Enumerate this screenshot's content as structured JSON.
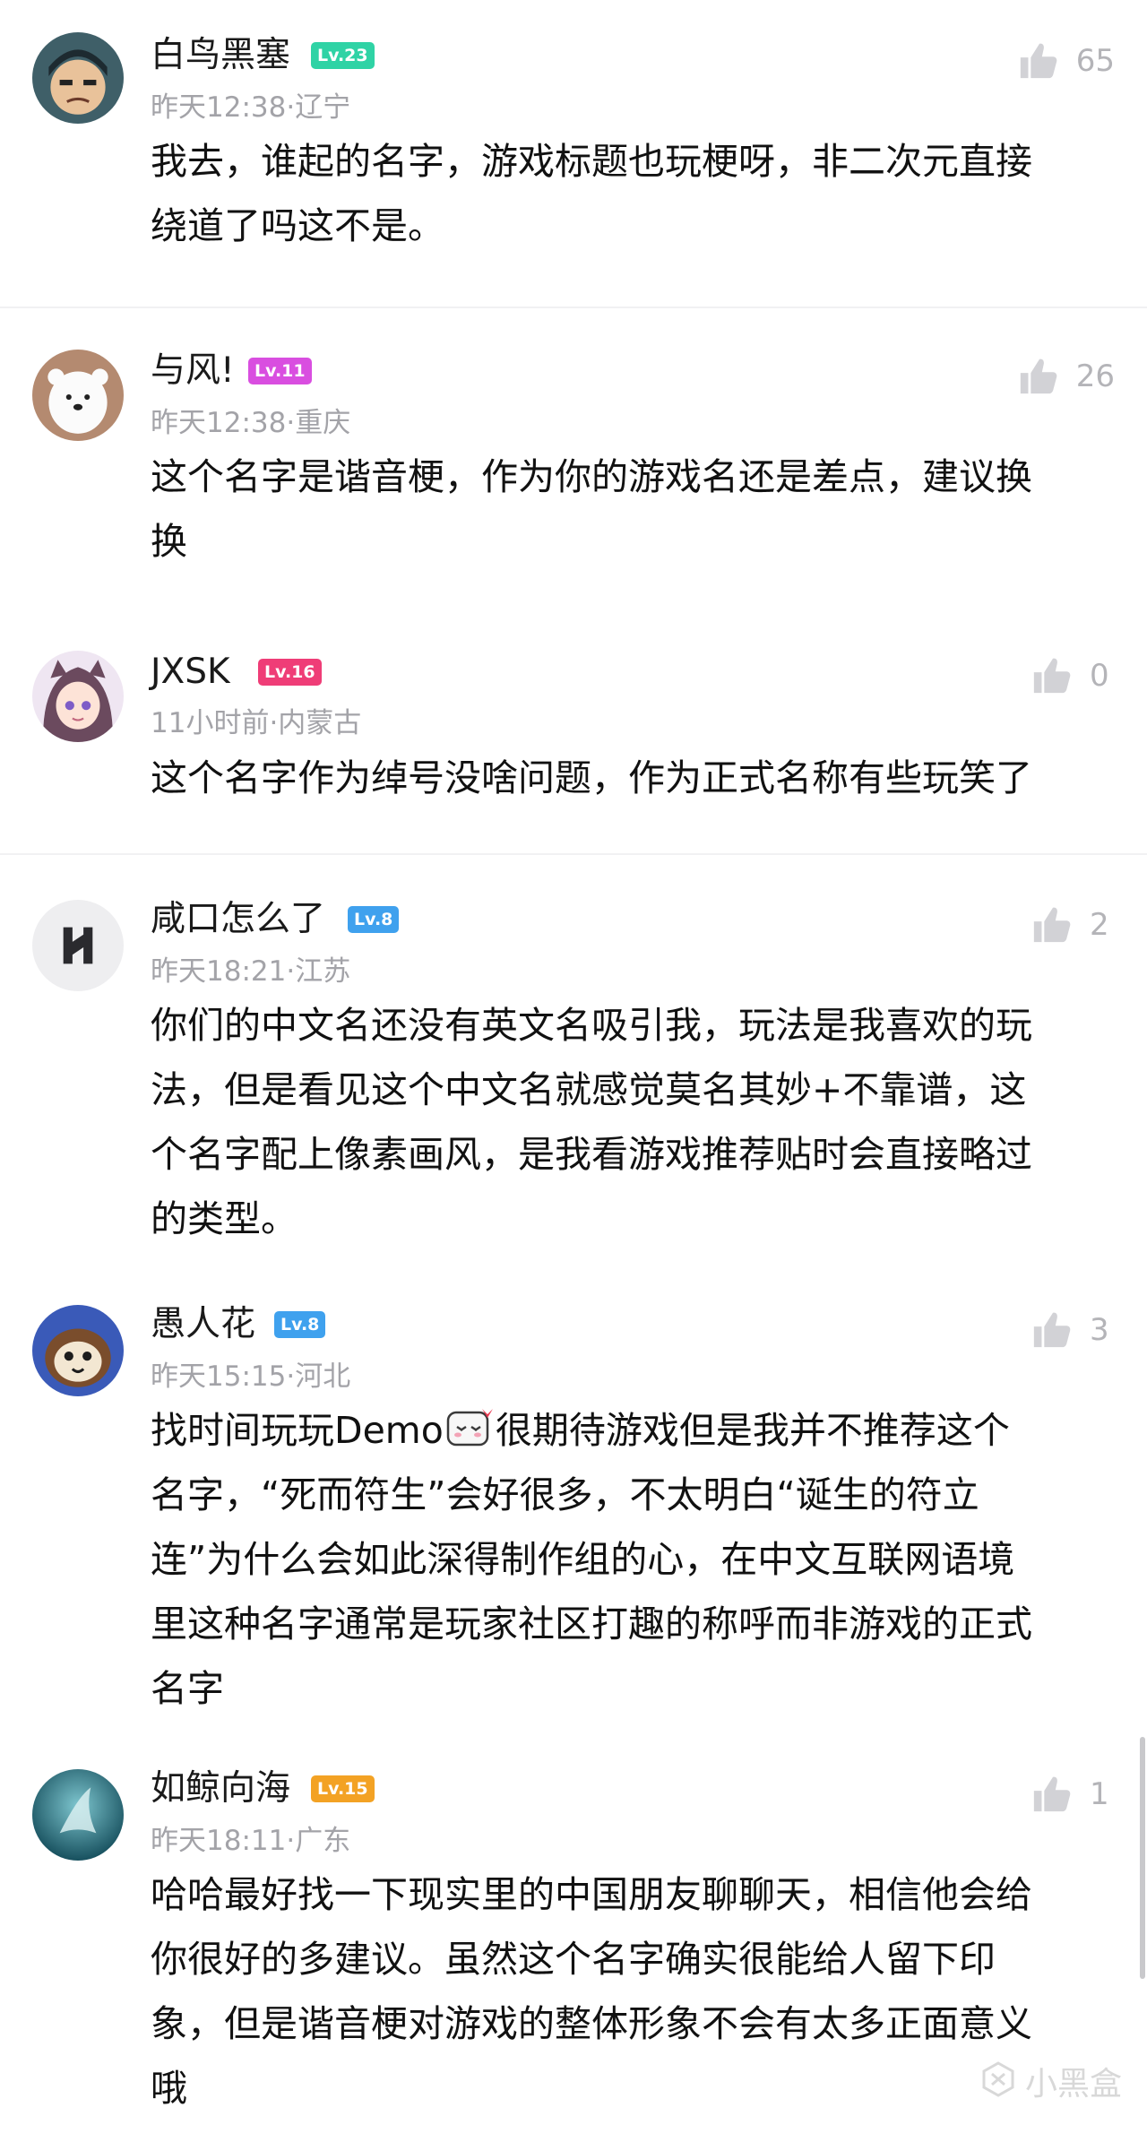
{
  "colors": {
    "level_green": "#2fd3a5",
    "level_magenta": "#d94ee0",
    "level_pink": "#ef3d77",
    "level_blue": "#3fa1ee",
    "level_orange": "#f3a224"
  },
  "comments": [
    {
      "username": "白鸟黑塞",
      "level": "Lv.23",
      "level_color": "#2fd3a5",
      "meta": "昨天12:38·辽宁",
      "likes": "65",
      "avatar": "cartoon-boy-avatar",
      "lines": [
        "我去，谁起的名字，游戏标题也玩梗呀，非二次元直接",
        "绕道了吗这不是。"
      ]
    },
    {
      "username": "与风!",
      "level": "Lv.11",
      "level_color": "#d94ee0",
      "meta": "昨天12:38·重庆",
      "likes": "26",
      "avatar": "polar-bear-avatar",
      "lines": [
        "这个名字是谐音梗，作为你的游戏名还是差点，建议换",
        "换"
      ]
    },
    {
      "username": "JXSK",
      "level": "Lv.16",
      "level_color": "#ef3d77",
      "meta": "11小时前·内蒙古",
      "likes": "0",
      "avatar": "anime-girl-avatar",
      "lines": [
        "这个名字作为绰号没啥问题，作为正式名称有些玩笑了"
      ]
    },
    {
      "username": "咸口怎么了",
      "level": "Lv.8",
      "level_color": "#3fa1ee",
      "meta": "昨天18:21·江苏",
      "likes": "2",
      "avatar": "logo-avatar",
      "lines": [
        "你们的中文名还没有英文名吸引我，玩法是我喜欢的玩",
        "法，但是看见这个中文名就感觉莫名其妙+不靠谱，这",
        "个名字配上像素画风，是我看游戏推荐贴时会直接略过",
        "的类型。"
      ]
    },
    {
      "username": "愚人花",
      "level": "Lv.8",
      "level_color": "#3fa1ee",
      "meta": "昨天15:15·河北",
      "likes": "3",
      "avatar": "cute-creature-avatar",
      "line1_before": "找时间玩玩Demo",
      "line1_after": "很期待游戏但是我并不推荐这个",
      "lines": [
        "名字，“死而符生”会好很多，不太明白“诞生的符立",
        "连”为什么会如此深得制作组的心，在中文互联网语境",
        "里这种名字通常是玩家社区打趣的称呼而非游戏的正式",
        "名字"
      ]
    },
    {
      "username": "如鲸向海",
      "level": "Lv.15",
      "level_color": "#f3a224",
      "meta": "昨天18:11·广东",
      "likes": "1",
      "avatar": "ocean-avatar",
      "lines": [
        "哈哈最好找一下现实里的中国朋友聊聊天，相信他会给",
        "你很好的多建议。虽然这个名字确实很能给人留下印",
        "象，但是谐音梗对游戏的整体形象不会有太多正面意义",
        "哦"
      ]
    }
  ],
  "watermark": "小黑盒"
}
